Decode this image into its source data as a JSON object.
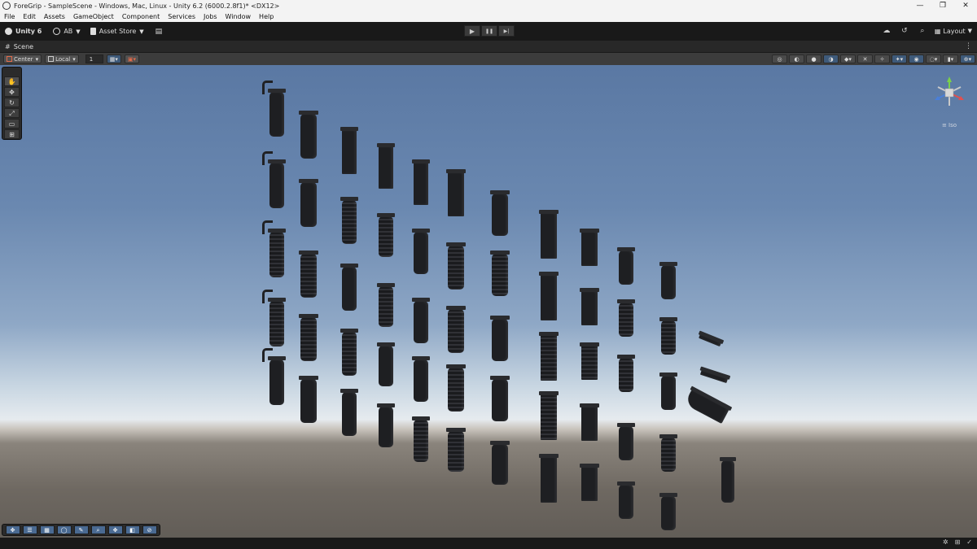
{
  "window": {
    "title": "ForeGrip - SampleScene - Windows, Mac, Linux - Unity 6.2 (6000.2.8f1)* <DX12>",
    "controls": [
      "—",
      "❐",
      "✕"
    ]
  },
  "menu": [
    "File",
    "Edit",
    "Assets",
    "GameObject",
    "Component",
    "Services",
    "Jobs",
    "Window",
    "Help"
  ],
  "toolbar": {
    "unity_label": "Unity 6",
    "account_label": "AB",
    "asset_store_label": "Asset Store",
    "layout_label": "Layout",
    "play_icons": [
      "▶",
      "❚❚",
      "▶|"
    ]
  },
  "scene_tab": {
    "label": "Scene"
  },
  "scene_tools": {
    "pivot_label": "Center",
    "space_label": "Local",
    "grid_value": "1"
  },
  "gizmo": {
    "label": "Iso"
  }
}
